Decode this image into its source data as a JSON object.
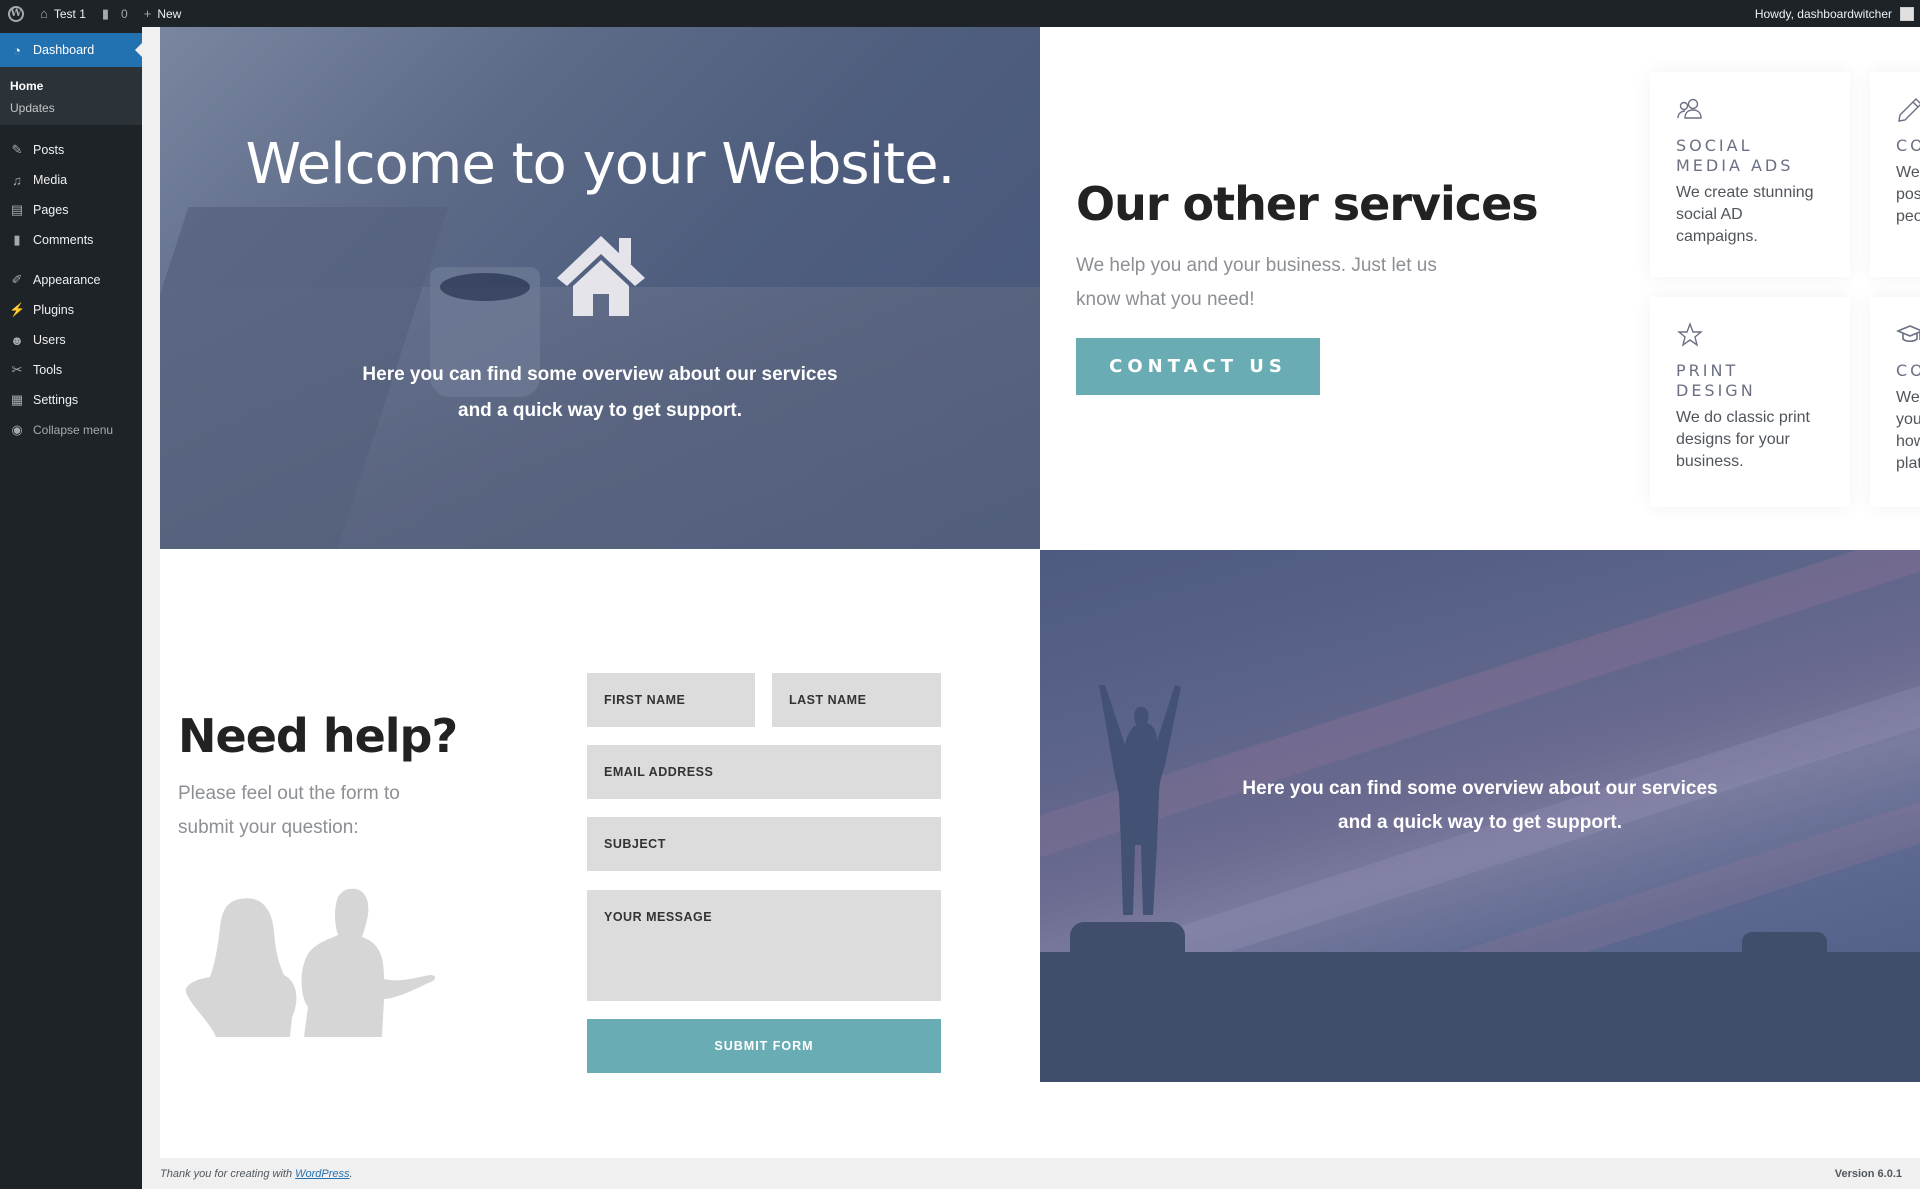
{
  "adminbar": {
    "site_name": "Test 1",
    "comments_count": "0",
    "new_label": "New",
    "greeting": "Howdy, dashboardwitcher"
  },
  "sidebar": {
    "dashboard_label": "Dashboard",
    "submenu": [
      {
        "label": "Home",
        "current": true
      },
      {
        "label": "Updates",
        "current": false
      }
    ],
    "items": [
      {
        "label": "Posts",
        "icon": "pin-icon"
      },
      {
        "label": "Media",
        "icon": "media-icon"
      },
      {
        "label": "Pages",
        "icon": "pages-icon"
      },
      {
        "label": "Comments",
        "icon": "comment-icon"
      },
      {
        "label": "Appearance",
        "icon": "paintbrush-icon"
      },
      {
        "label": "Plugins",
        "icon": "plugin-icon"
      },
      {
        "label": "Users",
        "icon": "user-icon"
      },
      {
        "label": "Tools",
        "icon": "wrench-icon"
      },
      {
        "label": "Settings",
        "icon": "settings-icon"
      }
    ],
    "collapse_label": "Collapse menu"
  },
  "hero": {
    "title": "Welcome to your Website.",
    "text": "Here you can find some overview about our services and a quick way to get support."
  },
  "services": {
    "title": "Our other services",
    "subtitle": "We help you and your business. Just let us know what you need!",
    "contact_label": "CONTACT US",
    "cards": [
      {
        "title": "SOCIAL MEDIA ADS",
        "text": "We create stunning social AD campaigns.",
        "icon": "users-icon"
      },
      {
        "title": "COPYWRITING",
        "text": "We write your blog posts to reach more people.",
        "icon": "pencil-icon"
      },
      {
        "title": "PRINT DESIGN",
        "text": "We do classic print designs for your business.",
        "icon": "star-icon"
      },
      {
        "title": "COACHING",
        "text": "We coach your and your team about how to use digital plattforms.",
        "icon": "graduation-cap-icon"
      }
    ]
  },
  "help": {
    "title": "Need help?",
    "subtitle": "Please feel out the form to submit your question:",
    "form": {
      "first_name": "FIRST NAME",
      "last_name": "LAST NAME",
      "email": "EMAIL ADDRESS",
      "subject": "SUBJECT",
      "message": "YOUR MESSAGE",
      "submit_label": "SUBMIT FORM"
    }
  },
  "support_banner": {
    "text": "Here you can find some overview about our services and a quick way to get support."
  },
  "footer": {
    "thanks_prefix": "Thank you for creating with ",
    "link_label": "WordPress",
    "thanks_suffix": ".",
    "version": "Version 6.0.1"
  },
  "colors": {
    "accent": "#2271b1",
    "button_teal": "#6aacb4",
    "admin_dark": "#1d2327"
  }
}
